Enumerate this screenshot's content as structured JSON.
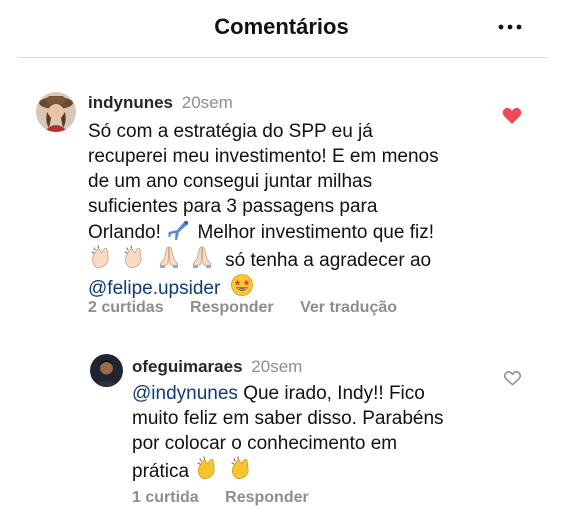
{
  "header": {
    "title": "Comentários"
  },
  "comments": [
    {
      "username": "indynunes",
      "time": "20sem",
      "text_line1": "Só com a estratégia do SPP eu já",
      "text_line2": "recuperei meu investimento! E em menos",
      "text_line3": "de um ano consegui juntar milhas",
      "text_line4": "suficientes para 3 passagens para",
      "text_line5": "Orlando!",
      "text_line5b": "Melhor investimento que fiz!",
      "text_line6": "só tenha a agradecer ao",
      "mention": "@felipe.upsider",
      "likes": "2 curtidas",
      "reply": "Responder",
      "translate": "Ver tradução",
      "liked": true,
      "emojis": {
        "line5": "airplane-icon",
        "line6": [
          "clapping-hands-icon",
          "clapping-hands-icon",
          "praying-hands-icon",
          "praying-hands-icon"
        ],
        "line7": "star-struck-face-icon"
      }
    },
    {
      "username": "ofeguimaraes",
      "time": "20sem",
      "mention": "@indynunes",
      "text_line1": "Que irado, Indy!! Fico",
      "text_line2": "muito feliz em saber disso. Parabéns",
      "text_line3": "por colocar o conhecimento em",
      "text_line4": "prática",
      "likes": "1 curtida",
      "reply": "Responder",
      "liked": false,
      "emojis": {
        "line4": [
          "clapping-hands-icon",
          "clapping-hands-icon"
        ]
      }
    }
  ],
  "colors": {
    "text": "#111111",
    "muted": "#8e8e8e",
    "mention": "#0f3a7a",
    "like_red": "#ed4956",
    "divider": "#dbdbdb"
  }
}
